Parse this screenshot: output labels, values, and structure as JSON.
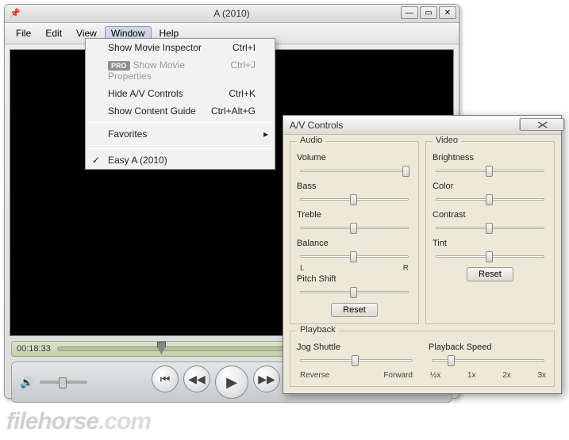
{
  "player": {
    "title": "A (2010)",
    "menus": {
      "file": "File",
      "edit": "Edit",
      "view": "View",
      "window": "Window",
      "help": "Help"
    },
    "timecode": "00:18:33"
  },
  "dropdown": {
    "show_inspector": {
      "label": "Show Movie Inspector",
      "shortcut": "Ctrl+I"
    },
    "show_props": {
      "label": "Show Movie Properties",
      "shortcut": "Ctrl+J",
      "badge": "PRO"
    },
    "hide_av": {
      "label": "Hide A/V Controls",
      "shortcut": "Ctrl+K"
    },
    "show_guide": {
      "label": "Show Content Guide",
      "shortcut": "Ctrl+Alt+G"
    },
    "favorites": "Favorites",
    "recent_0": "Easy A (2010)"
  },
  "av": {
    "title": "A/V Controls",
    "audio": {
      "legend": "Audio",
      "volume": "Volume",
      "bass": "Bass",
      "treble": "Treble",
      "balance": "Balance",
      "balance_l": "L",
      "balance_r": "R",
      "pitch": "Pitch Shift",
      "reset": "Reset"
    },
    "video": {
      "legend": "Video",
      "brightness": "Brightness",
      "color": "Color",
      "contrast": "Contrast",
      "tint": "Tint",
      "reset": "Reset"
    },
    "playback": {
      "legend": "Playback",
      "jog": "Jog Shuttle",
      "reverse": "Reverse",
      "forward": "Forward",
      "speed": "Playback Speed",
      "s_half": "½x",
      "s_1": "1x",
      "s_2": "2x",
      "s_3": "3x"
    }
  },
  "watermark": {
    "a": "filehorse",
    "b": ".com"
  }
}
